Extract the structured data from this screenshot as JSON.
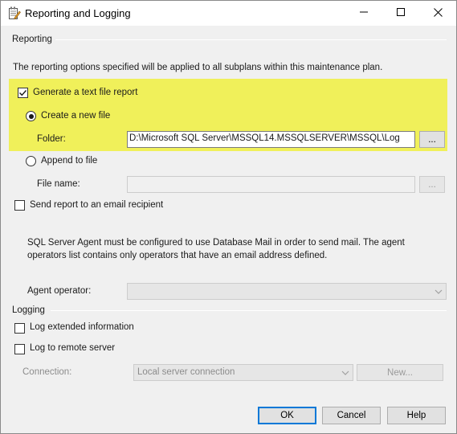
{
  "window": {
    "title": "Reporting and Logging",
    "icon": "notepad-pencil-icon",
    "controls": [
      "minimize-icon",
      "maximize-icon",
      "close-icon"
    ]
  },
  "reporting": {
    "section_title": "Reporting",
    "description": "The reporting options specified will be applied to all subplans within this maintenance plan.",
    "generate_report": {
      "label": "Generate a text file report",
      "checked": true
    },
    "create_new_file": {
      "label": "Create a new file",
      "selected": true
    },
    "folder": {
      "label": "Folder:",
      "value": "D:\\Microsoft SQL Server\\MSSQL14.MSSQLSERVER\\MSSQL\\Log",
      "browse_label": "..."
    },
    "append_to_file": {
      "label": "Append to file",
      "selected": false
    },
    "file_name": {
      "label": "File name:",
      "value": "",
      "browse_label": "..."
    },
    "send_email": {
      "label": "Send report to an email recipient",
      "checked": false
    },
    "agent_note": "SQL Server Agent must be configured to use Database Mail in order to send mail. The agent operators list contains only operators that have an email address defined.",
    "agent_operator": {
      "label": "Agent operator:",
      "value": ""
    }
  },
  "logging": {
    "section_title": "Logging",
    "log_extended": {
      "label": "Log extended information",
      "checked": false
    },
    "log_remote": {
      "label": "Log to remote server",
      "checked": false
    },
    "connection": {
      "label": "Connection:",
      "value": "Local server connection",
      "new_label": "New..."
    }
  },
  "buttons": {
    "ok": "OK",
    "cancel": "Cancel",
    "help": "Help"
  },
  "colors": {
    "highlight": "#f0f05a",
    "default_button_border": "#0078d7",
    "dialog_bg": "#f0f0f0"
  }
}
